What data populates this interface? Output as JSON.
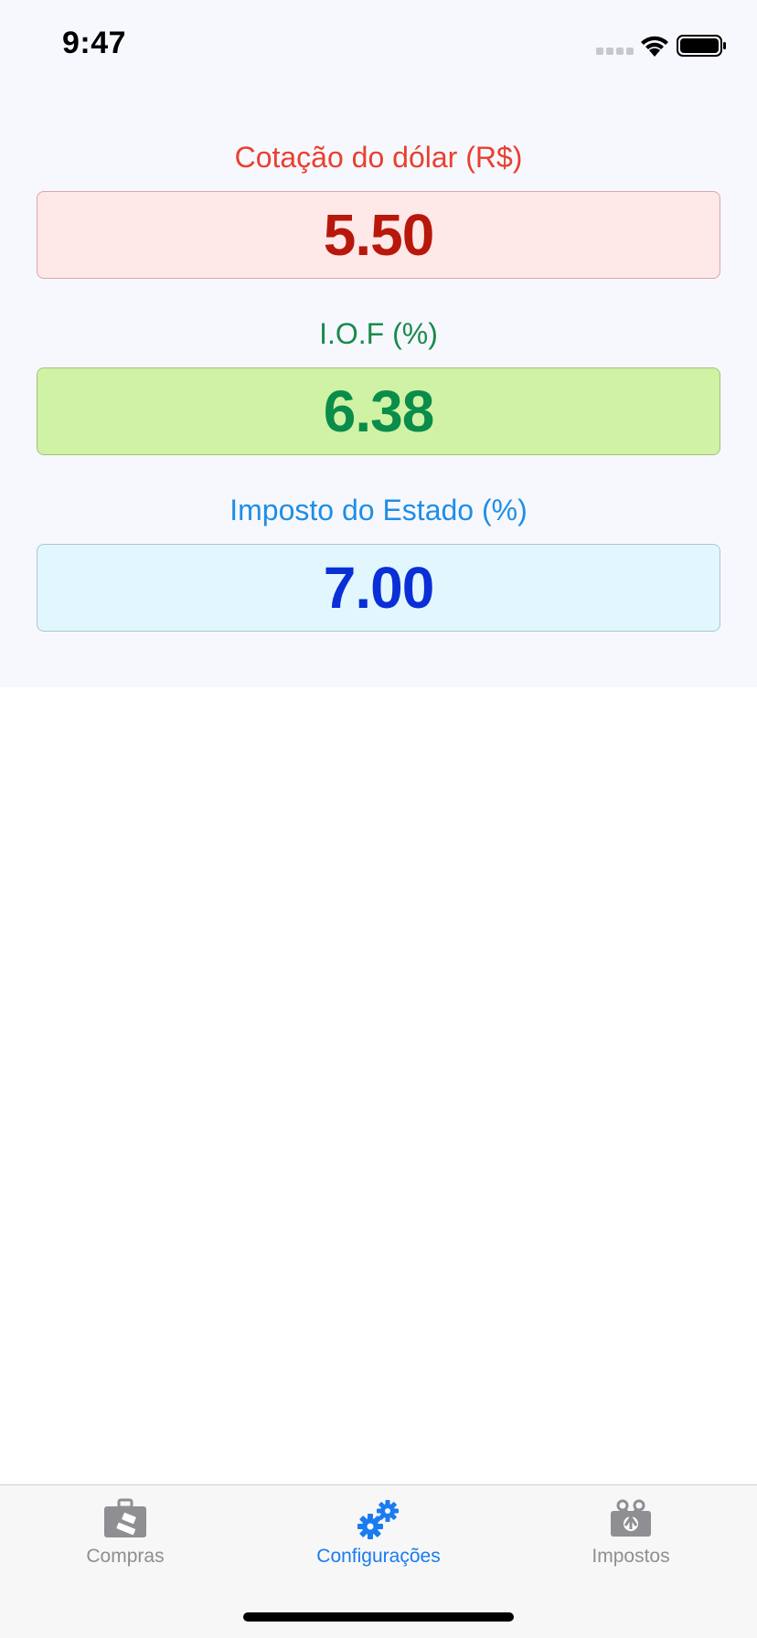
{
  "status_bar": {
    "time": "9:47"
  },
  "settings": {
    "dollar": {
      "label": "Cotação do dólar (R$)",
      "value": "5.50",
      "color": "#b8170b"
    },
    "iof": {
      "label": "I.O.F (%)",
      "value": "6.38",
      "color": "#0a8c4a"
    },
    "state_tax": {
      "label": "Imposto do Estado (%)",
      "value": "7.00",
      "color": "#0a2fd6"
    }
  },
  "tab_bar": {
    "active_color": "#1a7cf0",
    "items": [
      {
        "label": "Compras",
        "icon": "briefcase-icon",
        "active": false
      },
      {
        "label": "Configurações",
        "icon": "gears-icon",
        "active": true
      },
      {
        "label": "Impostos",
        "icon": "money-cut-icon",
        "active": false
      }
    ]
  }
}
